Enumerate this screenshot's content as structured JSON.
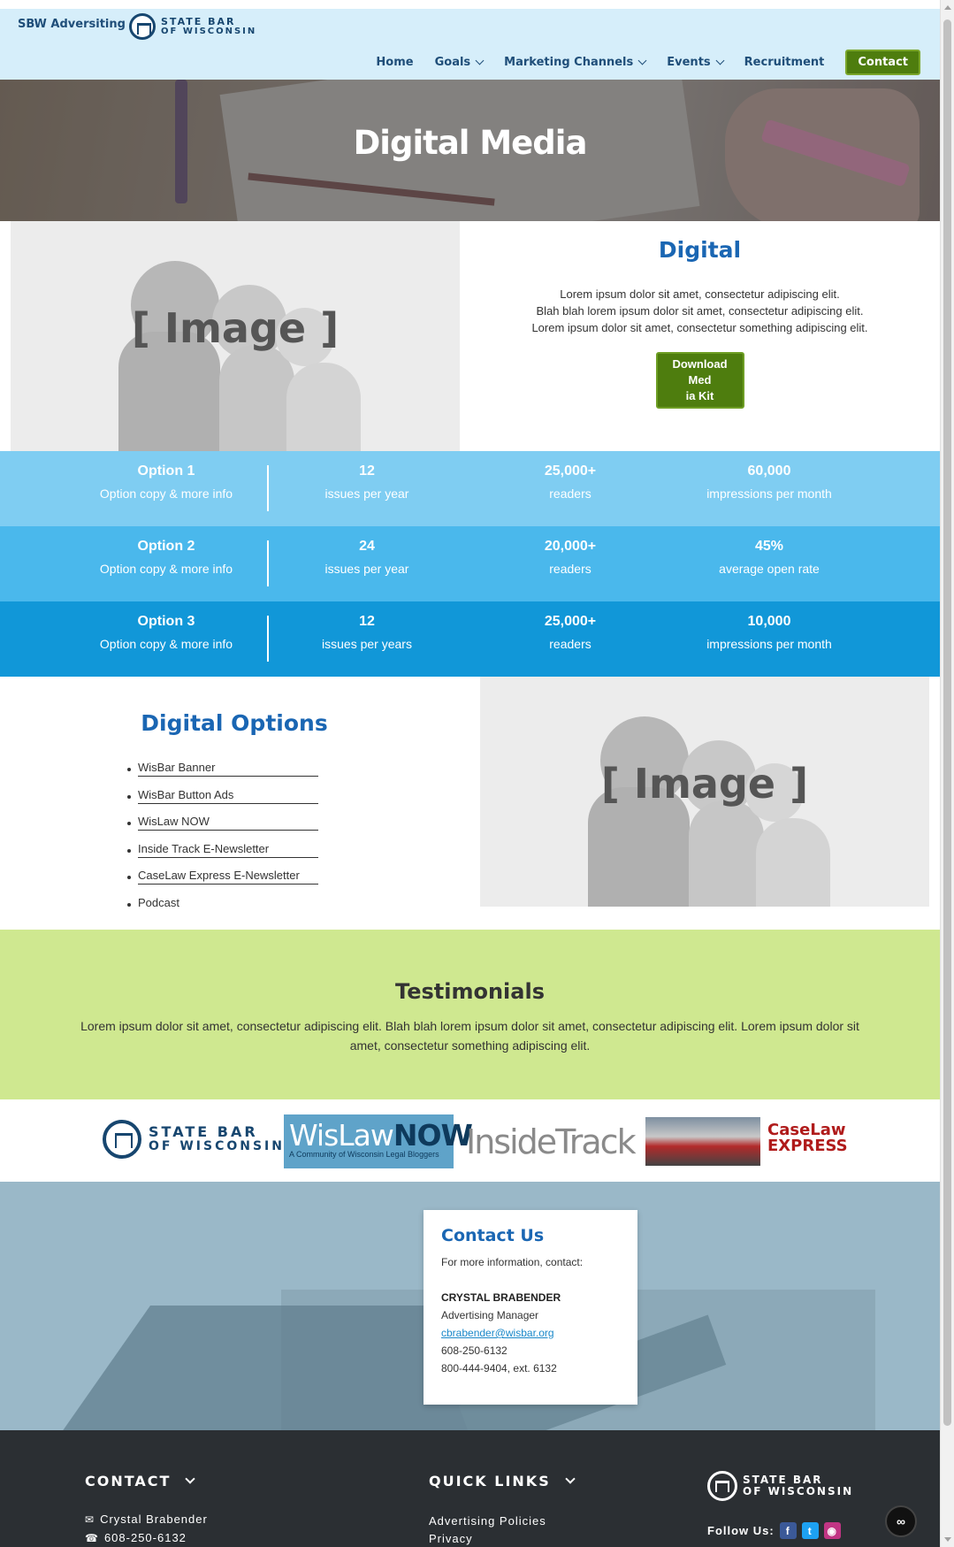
{
  "header": {
    "brand": "SBW Adversiting",
    "logo_line1": "STATE BAR",
    "logo_line2": "OF WISCONSIN",
    "nav": {
      "home": "Home",
      "goals": "Goals",
      "marketing": "Marketing Channels",
      "events": "Events",
      "recruitment": "Recruitment",
      "contact": "Contact"
    }
  },
  "hero": {
    "title": "Digital Media"
  },
  "placeholder_text": "[ Image ]",
  "digital": {
    "title": "Digital",
    "copy_line1": "Lorem ipsum dolor sit amet, consectetur adipiscing elit.",
    "copy_line2": "Blah blah lorem ipsum dolor sit amet, consectetur adipiscing elit.",
    "copy_line3": "Lorem ipsum dolor sit amet, consectetur something adipiscing elit.",
    "button_line1": "Download Med",
    "button_line2": "ia Kit"
  },
  "options_table": [
    {
      "name": "Option 1",
      "desc": "Option copy & more info",
      "issues": "12",
      "issues_label": "issues per year",
      "readers": "25,000+",
      "readers_label": "readers",
      "metric": "60,000",
      "metric_label": "impressions per month",
      "color": "#7fcdf2"
    },
    {
      "name": "Option 2",
      "desc": "Option copy & more info",
      "issues": "24",
      "issues_label": "issues per year",
      "readers": "20,000+",
      "readers_label": "readers",
      "metric": "45%",
      "metric_label": "average open rate",
      "color": "#4ab8ec"
    },
    {
      "name": "Option 3",
      "desc": "Option copy & more info",
      "issues": "12",
      "issues_label": "issues per years",
      "readers": "25,000+",
      "readers_label": "readers",
      "metric": "10,000",
      "metric_label": "impressions per month",
      "color": "#1197d8"
    }
  ],
  "digital_options": {
    "title": "Digital Options",
    "items": [
      "WisBar Banner",
      "WisBar Button Ads",
      "WisLaw NOW",
      "Inside Track E-Newsletter",
      "CaseLaw Express E-Newsletter",
      "Podcast"
    ]
  },
  "testimonials": {
    "title": "Testimonials",
    "text": "Lorem ipsum dolor sit amet, consectetur adipiscing elit. Blah blah lorem ipsum dolor sit amet, consectetur adipiscing elit. Lorem ipsum dolor sit amet, consectetur something adipiscing elit."
  },
  "logos": {
    "sbw_line1": "STATE BAR",
    "sbw_line2": "OF WISCONSIN",
    "wislaw_a": "WisLaw",
    "wislaw_b": "NOW",
    "wislaw_sub": "A Community of Wisconsin Legal Bloggers",
    "insidetrack": "InsideTrack",
    "caselaw_line1": "CaseLaw",
    "caselaw_line2": "EXPRESS"
  },
  "contact_card": {
    "title": "Contact Us",
    "intro": "For more information, contact:",
    "name": "CRYSTAL BRABENDER",
    "role": "Advertising Manager",
    "email": "cbrabender@wisbar.org",
    "phone": "608-250-6132",
    "phone2": "800-444-9404, ext. 6132"
  },
  "footer": {
    "contact_title": "CONTACT",
    "contact_name": "Crystal Brabender",
    "contact_phone": "608-250-6132",
    "links_title": "QUICK LINKS",
    "link1": "Advertising Policies",
    "link2": "Privacy",
    "logo_line1": "STATE BAR",
    "logo_line2": "OF WISCONSIN",
    "follow": "Follow Us:"
  },
  "colors": {
    "header_bg": "#d6eefa",
    "accent_green": "#4e7d0e",
    "heading_blue": "#1a66b3",
    "testimonial_bg": "#cfe890",
    "footer_bg": "#2b2f33"
  }
}
